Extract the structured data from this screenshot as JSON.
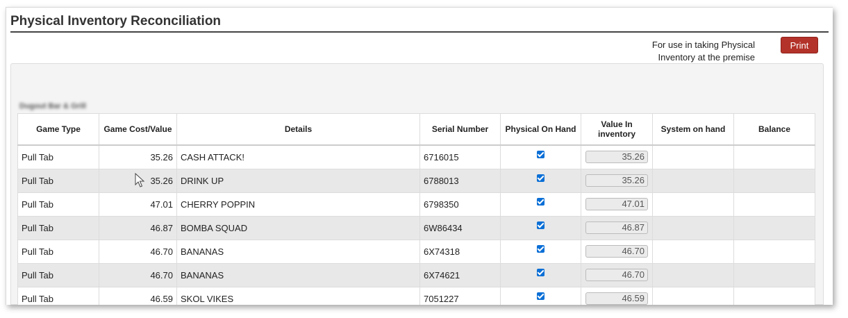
{
  "header": {
    "title": "Physical Inventory Reconciliation",
    "note": "For use in taking Physical Inventory at the premise",
    "print_label": "Print"
  },
  "premise_name": "Dugout Bar & Grill",
  "table": {
    "columns": [
      "Game Type",
      "Game Cost/Value",
      "Details",
      "Serial Number",
      "Physical On Hand",
      "Value In inventory",
      "System on hand",
      "Balance"
    ],
    "rows": [
      {
        "game_type": "Pull Tab",
        "cost": "35.26",
        "details": "CASH ATTACK!",
        "serial": "6716015",
        "physical_on_hand": true,
        "value": "35.26",
        "system_on_hand": "",
        "balance": ""
      },
      {
        "game_type": "Pull Tab",
        "cost": "35.26",
        "details": "DRINK UP",
        "serial": "6788013",
        "physical_on_hand": true,
        "value": "35.26",
        "system_on_hand": "",
        "balance": ""
      },
      {
        "game_type": "Pull Tab",
        "cost": "47.01",
        "details": "CHERRY POPPIN",
        "serial": "6798350",
        "physical_on_hand": true,
        "value": "47.01",
        "system_on_hand": "",
        "balance": ""
      },
      {
        "game_type": "Pull Tab",
        "cost": "46.87",
        "details": "BOMBA SQUAD",
        "serial": "6W86434",
        "physical_on_hand": true,
        "value": "46.87",
        "system_on_hand": "",
        "balance": ""
      },
      {
        "game_type": "Pull Tab",
        "cost": "46.70",
        "details": "BANANAS",
        "serial": "6X74318",
        "physical_on_hand": true,
        "value": "46.70",
        "system_on_hand": "",
        "balance": ""
      },
      {
        "game_type": "Pull Tab",
        "cost": "46.70",
        "details": "BANANAS",
        "serial": "6X74621",
        "physical_on_hand": true,
        "value": "46.70",
        "system_on_hand": "",
        "balance": ""
      },
      {
        "game_type": "Pull Tab",
        "cost": "46.59",
        "details": "SKOL VIKES",
        "serial": "7051227",
        "physical_on_hand": true,
        "value": "46.59",
        "system_on_hand": "",
        "balance": ""
      }
    ]
  },
  "colors": {
    "print_button": "#b33229",
    "checkbox": "#0b6fd6",
    "row_alt": "#e8e8e8"
  },
  "icons": {
    "checkbox": "checkbox-checked-icon",
    "cursor": "mouse-pointer-icon"
  }
}
